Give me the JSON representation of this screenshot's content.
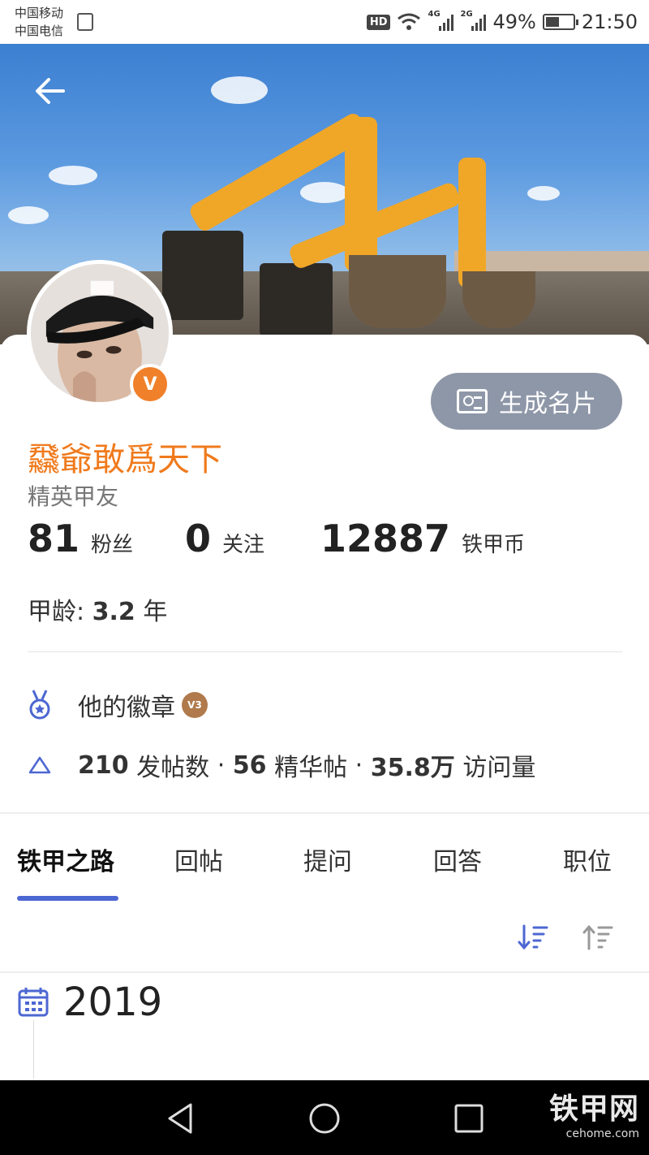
{
  "status_bar": {
    "carrier1": "中国移动",
    "carrier2": "中国电信",
    "hd": "HD",
    "net1": "4G",
    "net2": "2G",
    "battery": "49%",
    "battery_level": 0.49,
    "time": "21:50"
  },
  "profile": {
    "username": "飝爺敢爲天下",
    "level": "精英甲友",
    "verified_badge": "V",
    "generate_card_label": "生成名片",
    "stats": [
      {
        "num": "81",
        "label": "粉丝"
      },
      {
        "num": "0",
        "label": "关注"
      },
      {
        "num": "12887",
        "label": "铁甲币"
      }
    ],
    "age_label": "甲龄:",
    "age_value": "3.2",
    "age_unit": "年"
  },
  "badges": {
    "label": "他的徽章",
    "badge_text": "V3"
  },
  "posts": {
    "count": "210",
    "count_label": "发帖数",
    "sep": "·",
    "featured": "56",
    "featured_label": "精华帖",
    "views": "35.8万",
    "views_label": "访问量"
  },
  "tabs": [
    {
      "label": "铁甲之路",
      "active": true
    },
    {
      "label": "回帖",
      "active": false
    },
    {
      "label": "提问",
      "active": false
    },
    {
      "label": "回答",
      "active": false
    },
    {
      "label": "职位",
      "active": false
    }
  ],
  "timeline": {
    "year": "2019"
  },
  "watermark": {
    "main": "铁甲网",
    "sub": "cehome.com"
  },
  "colors": {
    "accent": "#4d67d2",
    "username": "#f07a1c",
    "card_button": "#8e97a8"
  }
}
